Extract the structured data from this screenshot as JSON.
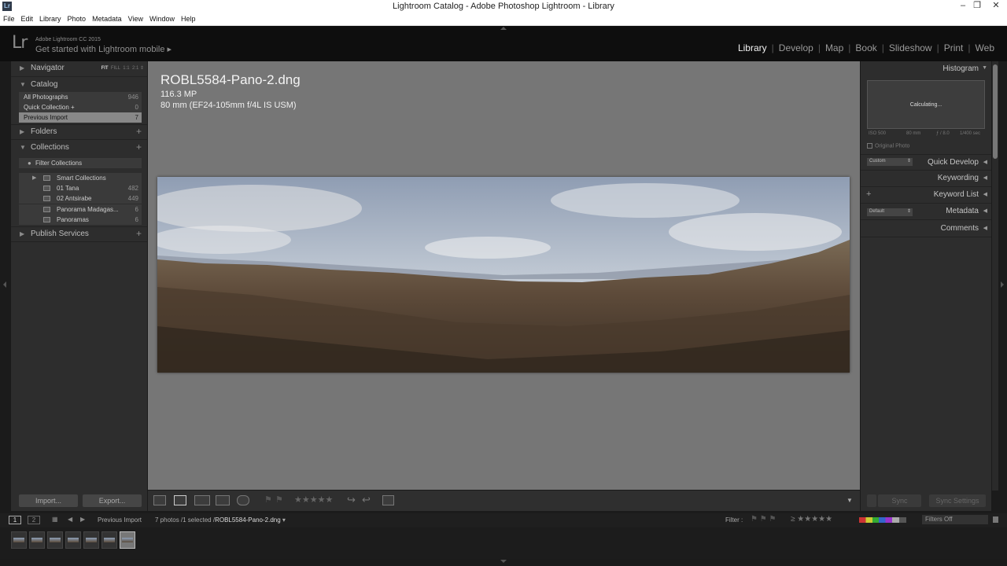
{
  "window": {
    "title": "Lightroom Catalog - Adobe Photoshop Lightroom - Library",
    "app_icon": "Lr",
    "controls": [
      "–",
      "❐",
      "✕"
    ]
  },
  "menu": [
    "File",
    "Edit",
    "Library",
    "Photo",
    "Metadata",
    "View",
    "Window",
    "Help"
  ],
  "identity": {
    "logo": "Lr",
    "version": "Adobe Lightroom CC 2015",
    "mobile_prompt": "Get started with Lightroom mobile ▸"
  },
  "modules": [
    "Library",
    "Develop",
    "Map",
    "Book",
    "Slideshow",
    "Print",
    "Web"
  ],
  "active_module": "Library",
  "left_panel": {
    "navigator": {
      "label": "Navigator",
      "opts": [
        "FIT",
        "FILL",
        "1:1",
        "2:1"
      ]
    },
    "catalog": {
      "label": "Catalog",
      "items": [
        {
          "label": "All Photographs",
          "count": "946"
        },
        {
          "label": "Quick Collection +",
          "count": "0"
        },
        {
          "label": "Previous Import",
          "count": "7"
        }
      ]
    },
    "folders": {
      "label": "Folders",
      "plus": "+"
    },
    "collections": {
      "label": "Collections",
      "plus": "+",
      "filter": "Filter Collections",
      "items": [
        {
          "label": "Smart Collections",
          "count": ""
        },
        {
          "label": "01 Tana",
          "count": "482"
        },
        {
          "label": "02 Antsirabe",
          "count": "449"
        },
        {
          "label": "Panorama Madagas...",
          "count": "6"
        },
        {
          "label": "Panoramas",
          "count": "6"
        }
      ]
    },
    "publish": {
      "label": "Publish Services",
      "plus": "+"
    },
    "import_button": "Import...",
    "export_button": "Export..."
  },
  "photo": {
    "filename": "ROBL5584-Pano-2.dng",
    "megapixels": "116.3 MP",
    "lens": "80 mm (EF24-105mm f/4L IS USM)"
  },
  "right_panel": {
    "histogram": {
      "label": "Histogram",
      "status": "Calculating...",
      "iso": "ISO 500",
      "focal": "80 mm",
      "aperture": "ƒ / 8.0",
      "shutter": "1/400 sec",
      "original_photo": "Original Photo"
    },
    "quick_develop": {
      "label": "Quick Develop",
      "preset": "Custom"
    },
    "keywording": {
      "label": "Keywording"
    },
    "keyword_list": {
      "label": "Keyword List"
    },
    "metadata": {
      "label": "Metadata",
      "preset": "Default"
    },
    "comments": {
      "label": "Comments"
    },
    "sync_button": "Sync",
    "sync_settings_button": "Sync Settings"
  },
  "filmbar": {
    "page1": "1",
    "page2": "2",
    "source": "Previous Import",
    "status_prefix": "7 photos /1 selected /",
    "current_file": "ROBL5584-Pano-2.dng",
    "filter_label": "Filter :",
    "filter_value": "Filters Off",
    "thumb_count": 7,
    "selected_thumb": 7
  },
  "colors": {
    "background": "#767676",
    "panel": "#2d2d2d",
    "active_module": "#f2f2f2",
    "selected_row": "#888888"
  }
}
